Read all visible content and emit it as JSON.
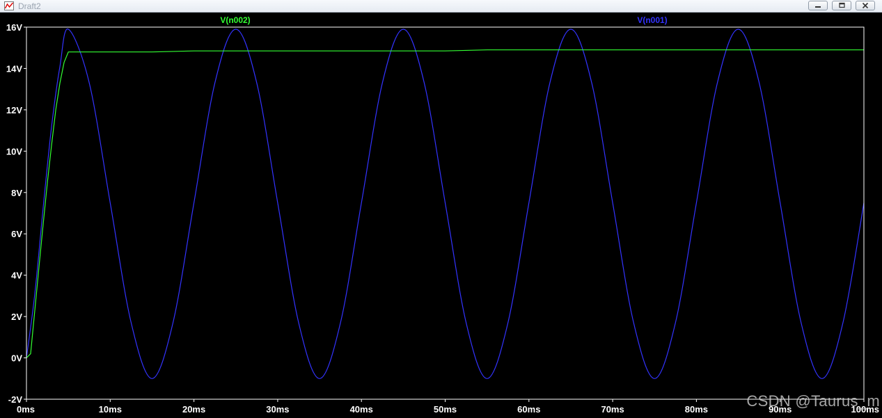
{
  "window": {
    "title": "Draft2"
  },
  "watermark": "CSDN @Taurus_m",
  "chart_data": {
    "type": "line",
    "xlabel": "",
    "ylabel": "",
    "xlim": [
      0,
      100
    ],
    "ylim": [
      -2,
      16
    ],
    "grid": false,
    "x_ticks": [
      "0ms",
      "10ms",
      "20ms",
      "30ms",
      "40ms",
      "50ms",
      "60ms",
      "70ms",
      "80ms",
      "90ms",
      "100ms"
    ],
    "y_ticks": [
      "-2V",
      "0V",
      "2V",
      "4V",
      "6V",
      "8V",
      "10V",
      "12V",
      "14V",
      "16V"
    ],
    "series": [
      {
        "name": "V(n002)",
        "color": "#33ff33",
        "x": [
          0,
          0.5,
          1,
          1.5,
          2,
          2.5,
          3,
          3.5,
          4,
          4.5,
          5,
          6,
          10,
          15,
          20,
          25,
          30,
          40,
          50,
          55,
          60,
          70,
          80,
          90,
          100
        ],
        "y": [
          0,
          0.2,
          2.3,
          4.4,
          6.5,
          8.5,
          10.3,
          12,
          13.3,
          14.3,
          14.8,
          14.8,
          14.8,
          14.8,
          14.85,
          14.85,
          14.85,
          14.85,
          14.85,
          14.9,
          14.9,
          14.9,
          14.9,
          14.9,
          14.9
        ]
      },
      {
        "name": "V(n001)",
        "color": "#3333ff",
        "x": [
          0,
          1,
          2,
          3,
          4,
          5,
          7.5,
          10,
          12.5,
          15,
          17.5,
          20,
          22.5,
          25,
          27.5,
          30,
          32.5,
          35,
          37.5,
          40,
          42.5,
          45,
          47.5,
          50,
          52.5,
          55,
          57.5,
          60,
          62.5,
          65,
          67.5,
          70,
          72.5,
          75,
          77.5,
          80,
          82.5,
          85,
          87.5,
          90,
          92.5,
          95,
          97.5,
          100
        ],
        "y": [
          0,
          3.1,
          7.3,
          11.2,
          14.1,
          15.9,
          13.3,
          7.5,
          1.7,
          -1.0,
          1.7,
          7.5,
          13.3,
          15.9,
          13.3,
          7.5,
          1.7,
          -1.0,
          1.7,
          7.5,
          13.3,
          15.9,
          13.3,
          7.5,
          1.7,
          -1.0,
          1.7,
          7.5,
          13.3,
          15.9,
          13.3,
          7.5,
          1.7,
          -1.0,
          1.7,
          7.5,
          13.3,
          15.9,
          13.3,
          7.5,
          1.7,
          -1.0,
          1.7,
          7.5
        ]
      }
    ]
  }
}
